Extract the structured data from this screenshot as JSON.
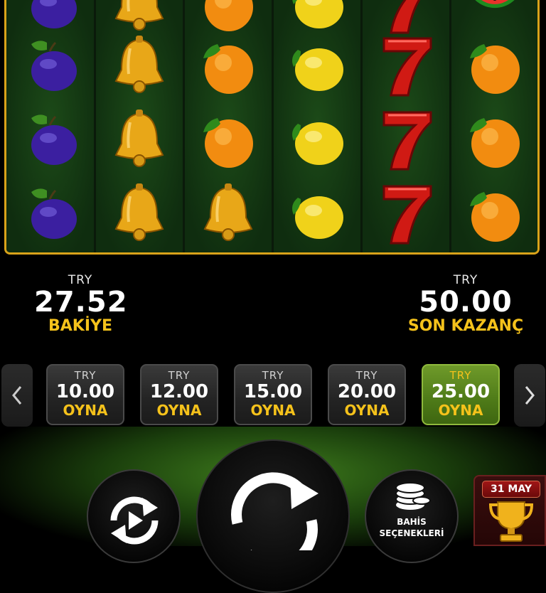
{
  "reels": [
    [
      "plum",
      "plum",
      "plum",
      "plum"
    ],
    [
      "bell",
      "bell",
      "bell",
      "bell"
    ],
    [
      "orange",
      "orange",
      "orange",
      "bell"
    ],
    [
      "lemon",
      "lemon",
      "lemon",
      "lemon"
    ],
    [
      "seven",
      "seven",
      "seven",
      "seven"
    ],
    [
      "watermelon",
      "orange",
      "orange",
      "orange"
    ]
  ],
  "balance": {
    "currency": "TRY",
    "amount": "27.52",
    "label": "BAKİYE"
  },
  "last_win": {
    "currency": "TRY",
    "amount": "50.00",
    "label": "SON KAZANÇ"
  },
  "bets": [
    {
      "currency": "TRY",
      "value": "10.00",
      "action": "OYNA",
      "active": false
    },
    {
      "currency": "TRY",
      "value": "12.00",
      "action": "OYNA",
      "active": false
    },
    {
      "currency": "TRY",
      "value": "15.00",
      "action": "OYNA",
      "active": false
    },
    {
      "currency": "TRY",
      "value": "20.00",
      "action": "OYNA",
      "active": false
    },
    {
      "currency": "TRY",
      "value": "25.00",
      "action": "OYNA",
      "active": true
    }
  ],
  "bet_options": {
    "line1": "BAHİS",
    "line2": "SEÇENEKLERİ"
  },
  "tournament": {
    "date": "31 MAY"
  },
  "colors": {
    "accent": "#f5c21b",
    "active_bet": "#4e7a18",
    "frame": "#d9a21a"
  }
}
